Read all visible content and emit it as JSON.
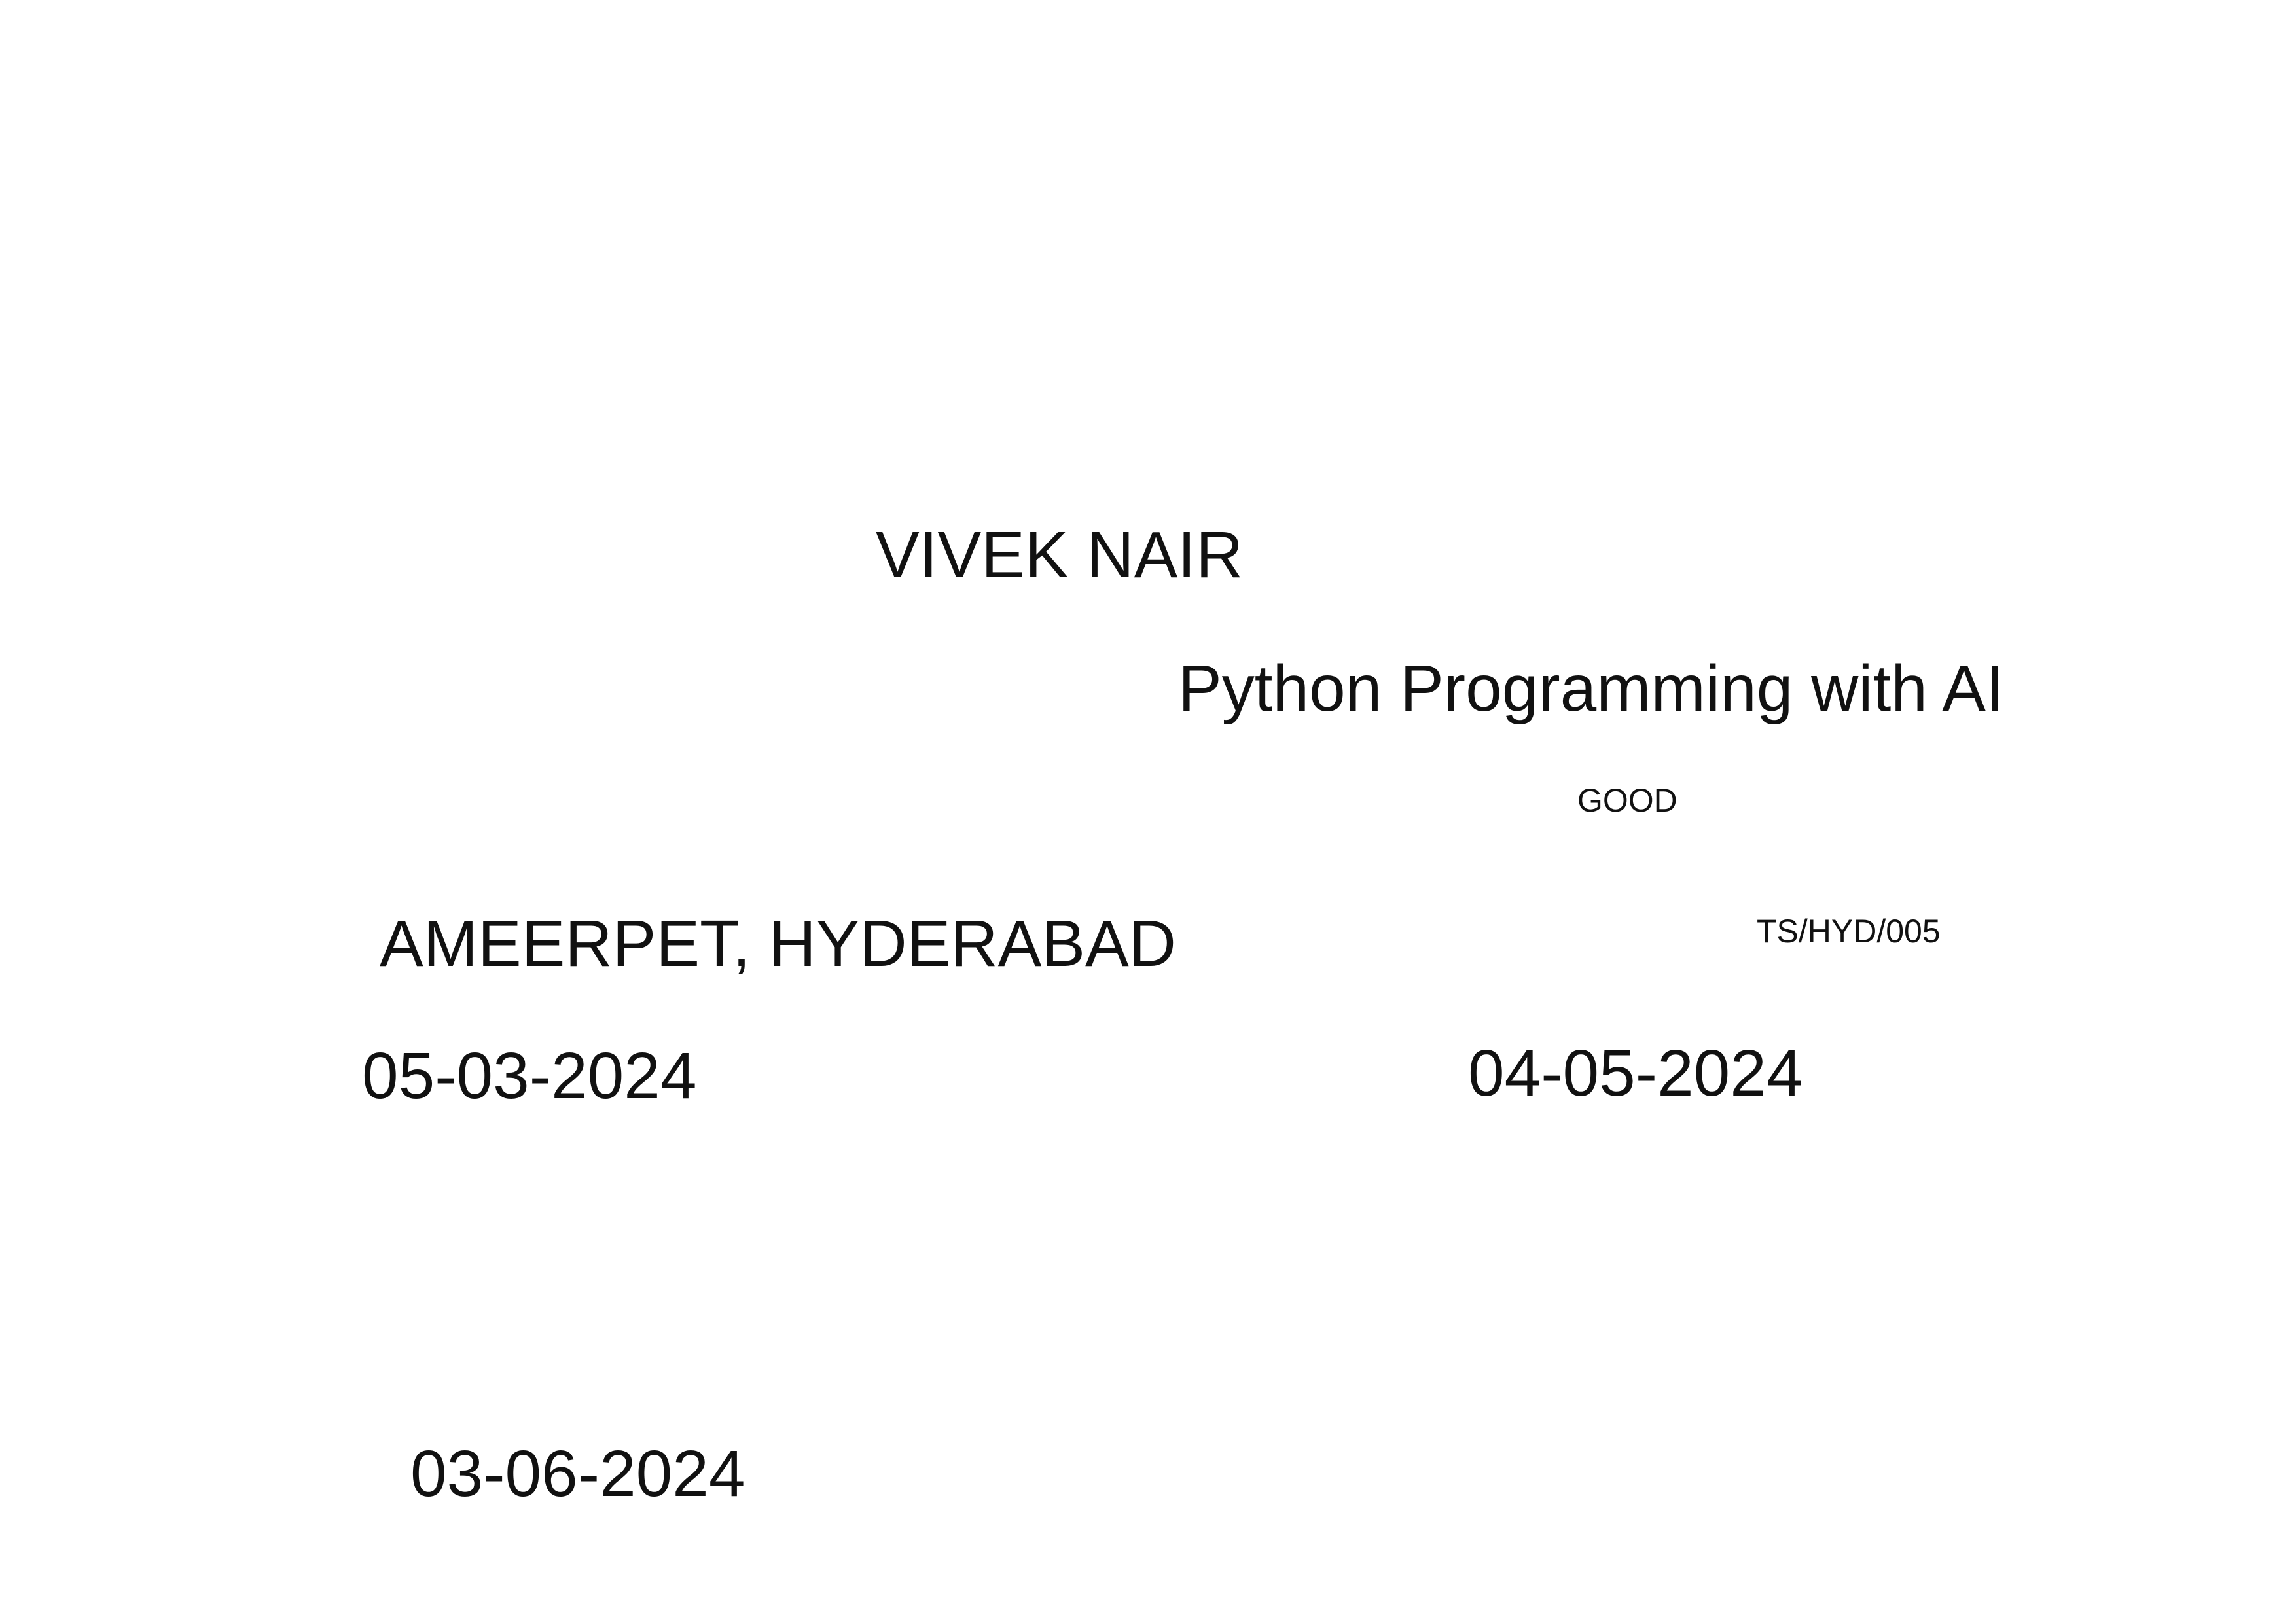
{
  "certificate": {
    "recipient_name": "VIVEK NAIR",
    "course_title": "Python Programming with AI",
    "grade": "GOOD",
    "location": "AMEERPET, HYDERABAD",
    "certificate_number": "TS/HYD/005",
    "start_date": "05-03-2024",
    "end_date": "04-05-2024",
    "issue_date": "03-06-2024"
  },
  "colors": {
    "background": "#ffffff",
    "text": "#111111"
  }
}
